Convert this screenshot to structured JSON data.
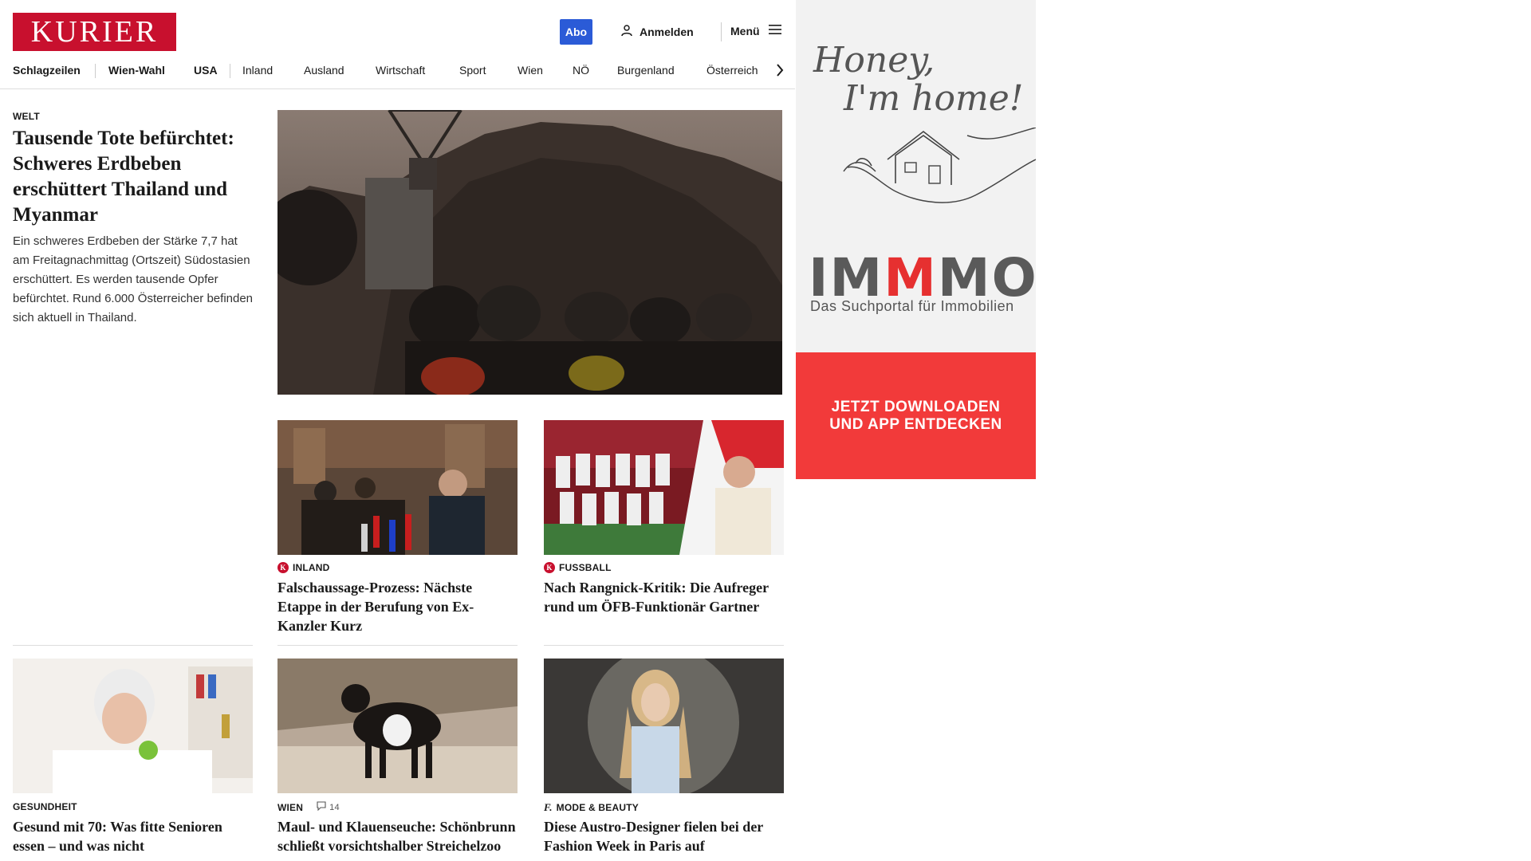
{
  "header": {
    "logo": "KURIER",
    "abo": "Abo",
    "login": "Anmelden",
    "menu": "Menü"
  },
  "nav": {
    "items": [
      "Schlagzeilen",
      "Wien-Wahl",
      "USA",
      "Inland",
      "Ausland",
      "Wirtschaft",
      "Sport",
      "Wien",
      "NÖ",
      "Burgenland",
      "Österreich"
    ]
  },
  "hero": {
    "kicker": "WELT",
    "title": "Tausende Tote befürchtet: Schweres Erdbeben erschüttert Thailand und Myanmar",
    "teaser": "Ein schweres Erdbeben der Stärke 7,7 hat am Freitagnachmittag (Ortszeit) Südostasien erschüttert. Es werden tausende Opfer befürchtet. Rund 6.000 Österreicher befinden sich aktuell in Thailand."
  },
  "cards": [
    {
      "kicker": "INLAND",
      "title": "Falschaussage-Prozess: Nächste Etappe in der Berufung von Ex-Kanzler Kurz"
    },
    {
      "kicker": "FUSSBALL",
      "title": "Nach Rangnick-Kritik: Die Aufreger rund um ÖFB-Funktionär Gartner"
    },
    {
      "kicker": "GESUNDHEIT",
      "title": "Gesund mit 70: Was fitte Senioren essen – und was nicht"
    },
    {
      "kicker": "WIEN",
      "comments": "14",
      "title": "Maul- und Klauenseuche: Schönbrunn schließt vorsichtshalber Streichelzoo"
    },
    {
      "kicker": "MODE & BEAUTY",
      "title": "Diese Austro-Designer fielen bei der Fashion Week in Paris auf"
    }
  ],
  "ad": {
    "script_line1": "Honey,",
    "script_line2": "I'm home!",
    "brand_a": "IM",
    "brand_m": "M",
    "brand_b": "MO",
    "subline": "Das Suchportal für Immobilien",
    "cta_line1": "JETZT DOWNLOADEN",
    "cta_line2": "UND APP ENTDECKEN"
  }
}
